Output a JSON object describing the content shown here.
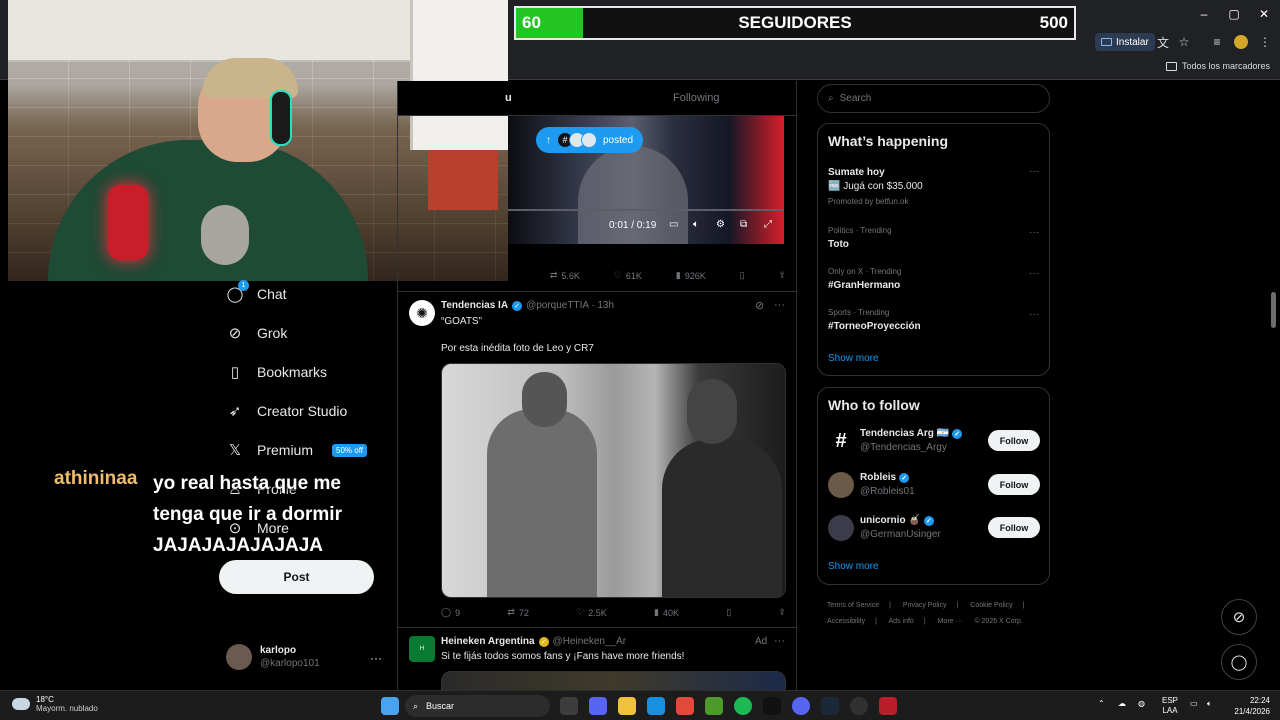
{
  "goal": {
    "current": "60",
    "label": "SEGUIDORES",
    "target": "500",
    "progress_fraction": 0.12
  },
  "chrome": {
    "install_label": "Instalar",
    "bookmarks_folder": "Todos los marcadores",
    "window": {
      "minimize": "–",
      "maximize": "▢",
      "close": "✕"
    }
  },
  "chat_overlay": {
    "username": "athininaa",
    "message": "yo real hasta que me tenga que ir a dormir JAJAJAJAJAJAJA"
  },
  "nav": {
    "items": [
      {
        "label": "Chat",
        "badge": "1"
      },
      {
        "label": "Grok"
      },
      {
        "label": "Bookmarks"
      },
      {
        "label": "Creator Studio"
      },
      {
        "label": "Premium",
        "badge": "50% off"
      },
      {
        "label": "Profile"
      },
      {
        "label": "More"
      }
    ],
    "post_label": "Post",
    "account": {
      "name": "karlopo",
      "handle": "@karlopo101",
      "more": "···"
    }
  },
  "timeline": {
    "tabs": {
      "for_you": "u",
      "following": "Following"
    },
    "posted_pill": {
      "arrow": "↑",
      "label": "posted"
    },
    "video": {
      "time": "0:01 / 0:19"
    },
    "video_tweet_actions": {
      "retweets": "5.6K",
      "likes": "61K",
      "views": "926K"
    },
    "tweets": [
      {
        "name": "Tendencias IA",
        "handle": "@porqueTTIA · 13h",
        "line1": "“GOATS”",
        "line2": "Por esta inédita foto de Leo y CR7",
        "actions": {
          "replies": "9",
          "retweets": "72",
          "likes": "2.5K",
          "views": "40K"
        }
      },
      {
        "name": "Heineken Argentina",
        "handle": "@Heineken__Ar",
        "ad": "Ad",
        "text": "Si te fijás todos somos fans y ¡Fans have more friends!"
      }
    ]
  },
  "right": {
    "search_placeholder": "Search",
    "whats_happening": {
      "title": "What’s happening",
      "promo": {
        "name": "Sumate hoy",
        "line": "🆓 Jugá con $35.000",
        "promoted": "Promoted by betfun.ok"
      },
      "trends": [
        {
          "meta": "Politics · Trending",
          "name": "Toto"
        },
        {
          "meta": "Only on X · Trending",
          "name": "#GranHermano"
        },
        {
          "meta": "Sports · Trending",
          "name": "#TorneoProyección"
        }
      ],
      "show_more": "Show more"
    },
    "who_to_follow": {
      "title": "Who to follow",
      "accounts": [
        {
          "name": "Tendencias Arg 🇦🇷",
          "handle": "@Tendencias_Argy",
          "button": "Follow"
        },
        {
          "name": "Robleis",
          "handle": "@Robleis01",
          "button": "Follow"
        },
        {
          "name": "unicornio 🧉",
          "handle": "@GermanUsinger",
          "button": "Follow"
        }
      ],
      "show_more": "Show more"
    },
    "footer": [
      "Terms of Service",
      "|",
      "Privacy Policy",
      "|",
      "Cookie Policy",
      "|",
      "Accessibility",
      "|",
      "Ads info",
      "|",
      "More ···",
      "© 2026 X Corp."
    ]
  },
  "taskbar": {
    "temp": "18°C",
    "weather": "Mayorm. nublado",
    "search": "Buscar",
    "lang1": "ESP",
    "lang2": "LAA",
    "time": "22:24",
    "date": "21/4/2026"
  }
}
